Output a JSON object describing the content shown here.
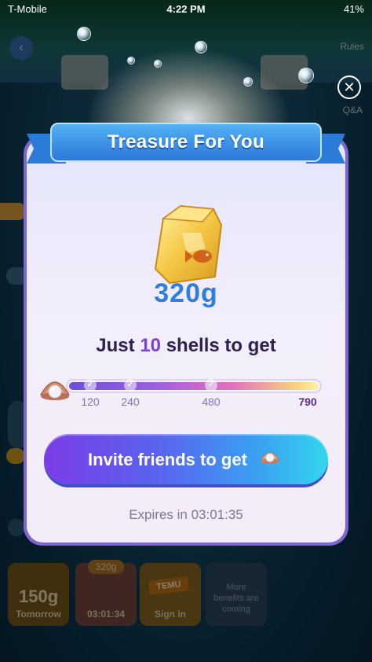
{
  "status_bar": {
    "carrier": "T-Mobile",
    "time": "4:22 PM",
    "battery": "41%"
  },
  "background": {
    "rules_label": "Rules",
    "qa_label": "Q&A",
    "tiles": [
      {
        "value": "150g",
        "caption": "Tomorrow"
      },
      {
        "badge": "320g",
        "caption": "03:01:34"
      },
      {
        "brand": "TEMU",
        "caption": "Sign in"
      },
      {
        "caption": "More benefits are coming"
      }
    ]
  },
  "modal": {
    "title": "Treasure For You",
    "prize_amount": "320g",
    "subline_prefix": "Just",
    "subline_count": "10",
    "subline_suffix": "shells to get",
    "progress": {
      "fill_fraction": 0.0,
      "milestones": [
        {
          "label": "120",
          "value": 120,
          "achieved": true
        },
        {
          "label": "240",
          "value": 240,
          "achieved": true
        },
        {
          "label": "480",
          "value": 480,
          "achieved": true
        },
        {
          "label": "790",
          "value": 790,
          "achieved": false
        }
      ],
      "max": 790
    },
    "button_label": "Invite friends to get",
    "expires_text": "Expires in 03:01:35"
  },
  "icons": {
    "close": "close-icon",
    "bag": "fish-bag-icon",
    "shell": "pearl-shell-icon"
  },
  "colors": {
    "accent_blue": "#2f7de0",
    "accent_purple": "#7a42d6",
    "ribbon": "#3c8fe6",
    "card_border": "#7d66d1"
  }
}
